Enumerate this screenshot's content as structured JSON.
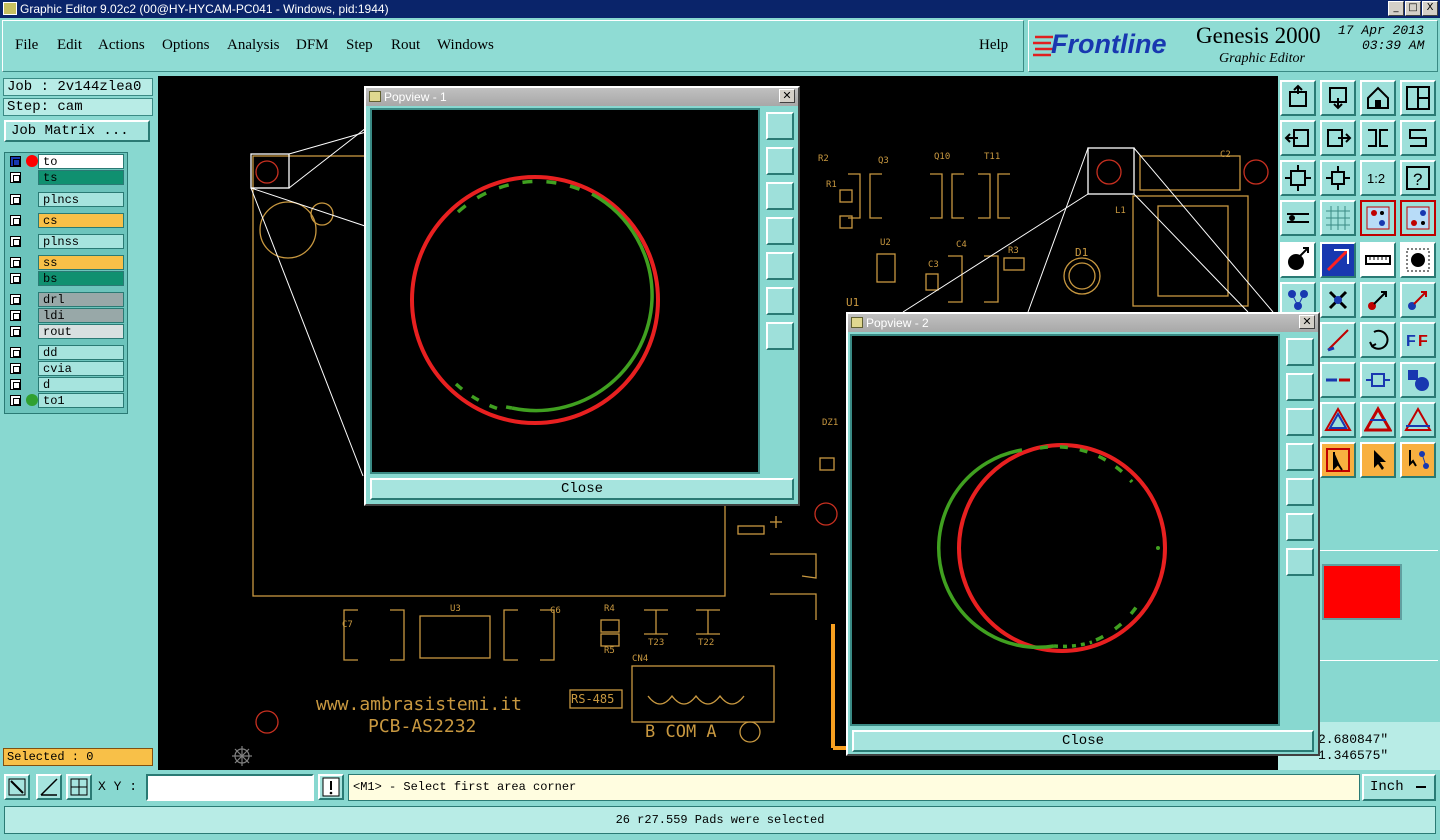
{
  "window": {
    "title": "Graphic Editor 9.02c2 (00@HY-HYCAM-PC041 - Windows, pid:1944)",
    "buttons": [
      "_",
      "□",
      "X"
    ]
  },
  "menu": {
    "items": [
      "File",
      "Edit",
      "Actions",
      "Options",
      "Analysis",
      "DFM",
      "Step",
      "Rout",
      "Windows"
    ],
    "help": "Help"
  },
  "logo": {
    "brand": "Frontline",
    "product": "Genesis 2000",
    "subtitle": "Graphic Editor",
    "date": "17 Apr 2013",
    "time": "03:39 AM"
  },
  "left": {
    "job": "Job : 2v144zlea0",
    "step": "Step: cam",
    "job_matrix": "Job Matrix ...",
    "layers": [
      {
        "name": "to",
        "color": "#ffffff",
        "dot": "#ff0000"
      },
      {
        "name": "ts",
        "color": "#109070",
        "dot": ""
      },
      {
        "name": "plncs",
        "color": "#a6e4de",
        "dot": ""
      },
      {
        "name": "cs",
        "color": "#f8c048",
        "dot": ""
      },
      {
        "name": "plnss",
        "color": "#a6e4de",
        "dot": ""
      },
      {
        "name": "ss",
        "color": "#f8c048",
        "dot": ""
      },
      {
        "name": "bs",
        "color": "#109070",
        "dot": ""
      },
      {
        "name": "drl",
        "color": "#98a8a8",
        "dot": ""
      },
      {
        "name": "ldi",
        "color": "#98a8a8",
        "dot": ""
      },
      {
        "name": "rout",
        "color": "#d8e0e0",
        "dot": ""
      },
      {
        "name": "dd",
        "color": "#a6e4de",
        "dot": ""
      },
      {
        "name": "cvia",
        "color": "#a6e4de",
        "dot": ""
      },
      {
        "name": "d",
        "color": "#a6e4de",
        "dot": ""
      },
      {
        "name": "to1",
        "color": "#a6e4de",
        "dot": "#30a030"
      }
    ],
    "selected": "Selected : 0"
  },
  "popview1": {
    "title": "Popview - 1",
    "close": "Close"
  },
  "popview2": {
    "title": "Popview - 2",
    "close": "Close"
  },
  "pcb": {
    "url": "www.ambrasistemi.it",
    "board": "PCB-AS2232",
    "rs485": "RS-485",
    "connector": "B COM A",
    "refs": [
      "R2",
      "R1",
      "U2",
      "C4",
      "C3",
      "R3",
      "D1",
      "C2",
      "U1",
      "L1",
      "C7",
      "U3",
      "C6",
      "R4",
      "R5",
      "T23",
      "T22",
      "CN4",
      "DZ1",
      "Q3",
      "Q10",
      "T11"
    ]
  },
  "coords": {
    "x": "2.680847\"",
    "y": "1.346575\""
  },
  "bottom": {
    "xy_label": "X Y :",
    "xy_value": "",
    "prompt": "<M1> - Select first area corner",
    "unit": "Inch",
    "status": "26 r27.559 Pads were selected"
  }
}
